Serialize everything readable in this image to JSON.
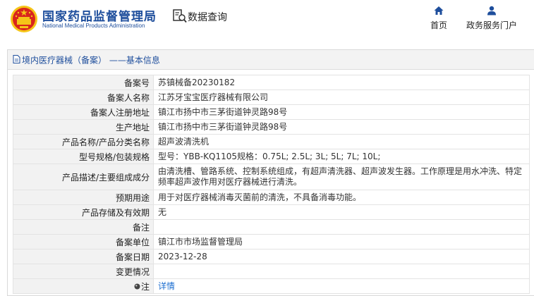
{
  "header": {
    "brand_cn": "国家药品监督管理局",
    "brand_en": "National Medical Products Administration",
    "query_label": "数据查询",
    "nav": {
      "home": "首页",
      "portal": "政务服务门户"
    }
  },
  "panel": {
    "title": "境内医疗器械（备案） ——基本信息"
  },
  "rows": [
    {
      "label": "备案号",
      "value": "苏镇械备20230182"
    },
    {
      "label": "备案人名称",
      "value": "江苏牙宝宝医疗器械有限公司"
    },
    {
      "label": "备案人注册地址",
      "value": "镇江市扬中市三茅街道钟灵路98号"
    },
    {
      "label": "生产地址",
      "value": "镇江市扬中市三茅街道钟灵路98号"
    },
    {
      "label": "产品名称/产品分类名称",
      "value": "超声波清洗机"
    },
    {
      "label": "型号规格/包装规格",
      "value": "型号：YBB-KQ1105规格：0.75L; 2.5L; 3L; 5L; 7L; 10L;"
    },
    {
      "label": "产品描述/主要组成成分",
      "value": "由清洗槽、管路系统、控制系统组成，有超声清洗器、超声波发生器。工作原理是用水冲洗、特定频率超声波作用对医疗器械进行清洗。"
    },
    {
      "label": "预期用途",
      "value": "用于对医疗器械消毒灭菌前的清洗，不具备消毒功能。"
    },
    {
      "label": "产品存储及有效期",
      "value": "无"
    },
    {
      "label": "备注",
      "value": ""
    },
    {
      "label": "备案单位",
      "value": "镇江市市场监督管理局"
    },
    {
      "label": "备案日期",
      "value": "2023-12-28"
    },
    {
      "label": "变更情况",
      "value": ""
    }
  ],
  "note_row": {
    "label": "注",
    "link": "详情"
  },
  "colors": {
    "brand_blue": "#1e4e9c",
    "link_blue": "#1e6fd0",
    "label_bg": "#f2f2f2",
    "emblem_red": "#d9251d",
    "emblem_gold": "#f5c518"
  },
  "icons": {
    "logo": "national-emblem-icon",
    "query": "search-document-icon",
    "home": "home-icon",
    "portal": "user-icon",
    "panel": "document-icon",
    "note": "pin-icon"
  }
}
